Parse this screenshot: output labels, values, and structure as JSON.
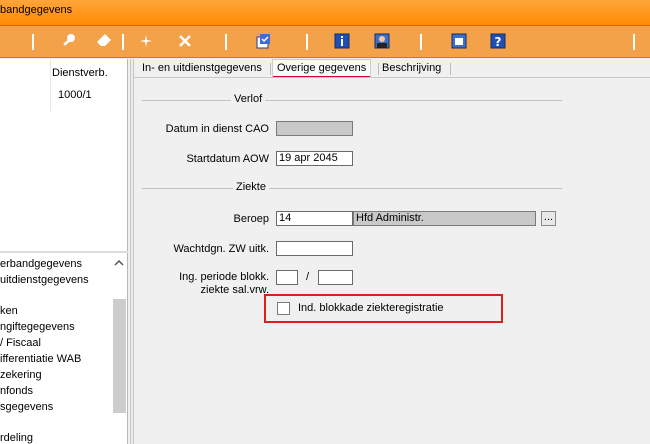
{
  "window": {
    "title": "bandgegevens"
  },
  "toolbar": {
    "icons": [
      "key-icon",
      "eraser-icon",
      "sparkle-icon",
      "tools-icon",
      "checklist-icon",
      "info-icon",
      "person-icon",
      "calendar-icon",
      "help-icon"
    ]
  },
  "left_panel": {
    "column_header": "Dienstverb.",
    "column_value": "1000/1",
    "nav_items": [
      "erbandgegevens",
      "uitdienstgegevens",
      "",
      "ken",
      "ngiftegegevens",
      "/ Fiscaal",
      "ifferentiatie WAB",
      "zekering",
      "nfonds",
      "sgegevens",
      "",
      "rdeling"
    ]
  },
  "tabs": [
    "In- en uitdienstgegevens",
    "Overige gegevens",
    "Beschrijving"
  ],
  "groups": {
    "verlof": "Verlof",
    "ziekte": "Ziekte"
  },
  "fields": {
    "datum_in_dienst_cao": {
      "label": "Datum in dienst CAO",
      "value": ""
    },
    "startdatum_aow": {
      "label": "Startdatum AOW",
      "value": "19 apr 2045"
    },
    "beroep": {
      "label": "Beroep",
      "code": "14",
      "description": "Hfd Administr.",
      "lookup": "..."
    },
    "wachtdgn": {
      "label": "Wachtdgn. ZW uitk.",
      "value": ""
    },
    "ing_periode": {
      "label_line1": "Ing. periode blokk.",
      "label_line2": "ziekte sal.vrw.",
      "value_from": "",
      "separator": "/",
      "value_to": ""
    },
    "ind_blokkade": {
      "label": "Ind. blokkade ziekteregistratie",
      "checked": false
    }
  }
}
